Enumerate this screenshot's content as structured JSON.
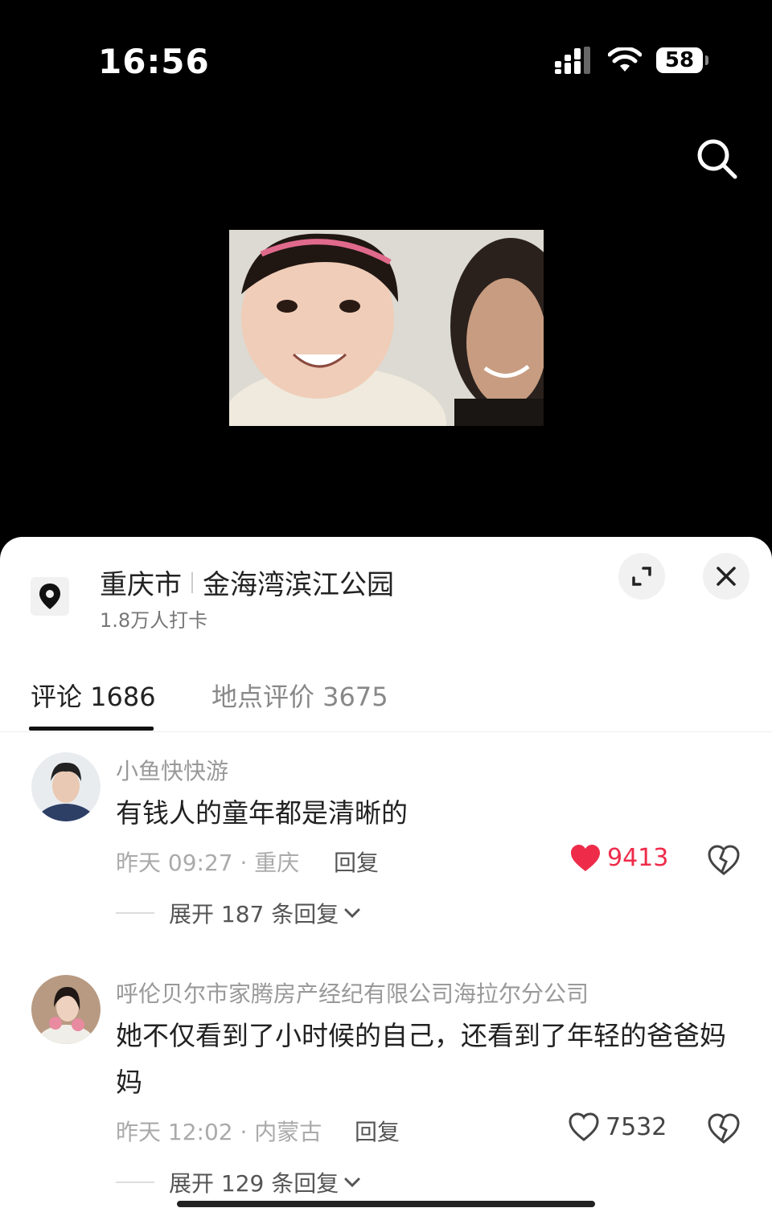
{
  "status_bar": {
    "time": "16:56",
    "battery": "58"
  },
  "location": {
    "city": "重庆市",
    "place": "金海湾滨江公园",
    "checkins": "1.8万人打卡"
  },
  "tabs": [
    {
      "label": "评论 1686",
      "active": true
    },
    {
      "label": "地点评价 3675",
      "active": false
    }
  ],
  "comments": [
    {
      "user": "小鱼快快游",
      "text": "有钱人的童年都是清晰的",
      "meta": "昨天 09:27 · 重庆",
      "reply": "回复",
      "likes": "9413",
      "liked": true,
      "expand": "展开 187 条回复"
    },
    {
      "user": "呼伦贝尔市家腾房产经纪有限公司海拉尔分公司",
      "text": "她不仅看到了小时候的自己，还看到了年轻的爸爸妈妈",
      "meta": "昨天 12:02 · 内蒙古",
      "reply": "回复",
      "likes": "7532",
      "liked": false,
      "expand": "展开 129 条回复"
    }
  ],
  "colors": {
    "like_red": "#ee2c4a",
    "sheet_bg": "#ffffff",
    "top_bg": "#000000"
  },
  "icons": [
    "signal-icon",
    "wifi-icon",
    "battery-icon",
    "search-icon",
    "location-pin-icon",
    "expand-icon",
    "close-icon",
    "heart-icon",
    "dislike-icon",
    "chevron-down-icon"
  ]
}
